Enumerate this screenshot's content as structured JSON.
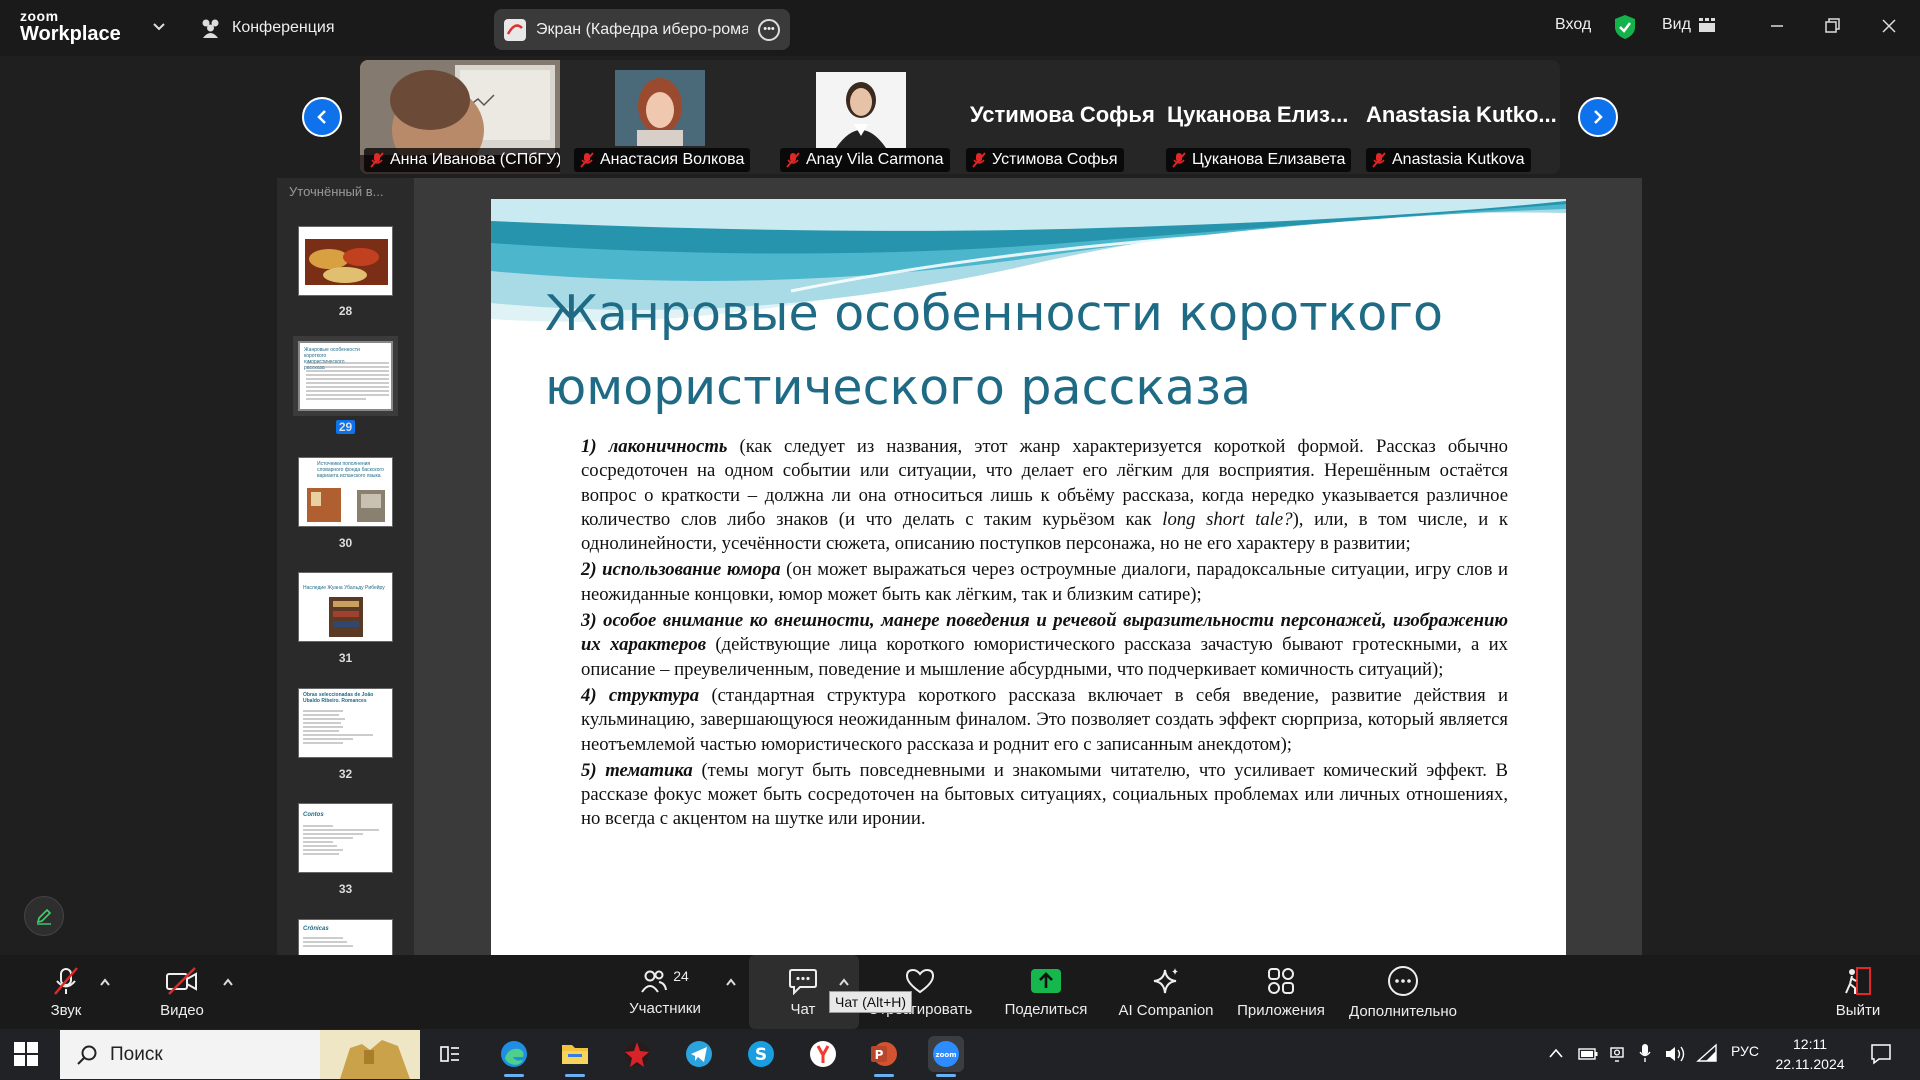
{
  "app": {
    "logo_top": "zoom",
    "logo_bottom": "Workplace",
    "conference_label": "Конференция",
    "share_title": "Экран (Кафедра иберо-романс",
    "sign_in": "Вход",
    "view": "Вид"
  },
  "gallery": {
    "participants": [
      {
        "name": "Анна Иванова (СПбГУ)"
      },
      {
        "name": "Анастасия Волкова"
      },
      {
        "name": "Anay Vila Carmona"
      },
      {
        "name": "Устимова Софья",
        "big": "Устимова Софья"
      },
      {
        "name": "Цуканова Елизавета",
        "big": "Цуканова Елиз..."
      },
      {
        "name": "Anastasia Kutkova",
        "big": "Anastasia Kutko..."
      }
    ]
  },
  "sidebar": {
    "title": "Уточнённый в...",
    "thumbs": [
      {
        "num": "28"
      },
      {
        "num": "29",
        "title": "Жанровые особенности короткого юмористического рассказа"
      },
      {
        "num": "30",
        "title": "Источники пополнения словарного фонда баскского варианта испанского языка"
      },
      {
        "num": "31",
        "title": "Наследие Жуана Убальду Рибейру"
      },
      {
        "num": "32",
        "title": "Obras seleccionadas de João Ubaldo Ribeiro. Romances"
      },
      {
        "num": "33",
        "title": "Contos"
      },
      {
        "num": "34",
        "title": "Crônicas"
      }
    ]
  },
  "slide": {
    "title_line1": "Жанровые особенности короткого",
    "title_line2": "юмористического рассказа",
    "items": [
      {
        "head": "1) лаконичность",
        "text": " (как следует из названия, этот жанр характеризуется короткой формой. Рассказ обычно сосредоточен на одном событии или ситуации, что делает его лёгким для восприятия. Нерешённым остаётся вопрос о краткости – должна ли она относиться лишь к объёму рассказа, когда нередко указывается различное количество слов либо знаков (и что делать с таким курьёзом как ",
        "italic": "long short tale?",
        "tail": "), или, в том числе,   и к однолинейности, усечённости  сюжета, описанию поступков персонажа, но не его характеру в развитии;"
      },
      {
        "head": "2) использование юмора",
        "text": " (он может выражаться через остроумные диалоги, парадоксальные ситуации, игру слов и неожиданные концовки, юмор может быть как лёгким, так и близким сатире);"
      },
      {
        "head": "3) особое внимание ко внешности, манере поведения и речевой выразительности  персонажей, изображению их  характеров",
        "text": "  (действующие  лица  короткого юмористического рассказа зачастую бывают гротескными, а их описание – преувеличенным,  поведение и мышление абсурдными, что подчеркивает комичность ситуаций);"
      },
      {
        "head": "4) структура",
        "text": " (стандартная структура короткого рассказа включает в себя введение, развитие действия и кульминацию, завершающуюся неожиданным финалом. Это позволяет создать эффект сюрприза, который является неотъемлемой частью юмористического рассказа и роднит его с записанным анекдотом);"
      },
      {
        "head": "5) тематика",
        "text": " (темы могут быть повседневными и знакомыми читателю, что усиливает комический эффект. В рассказе фокус может быть сосредоточен на бытовых ситуациях, социальных проблемах или личных отношениях, но всегда с акцентом на шутке или иронии."
      }
    ]
  },
  "toolbar": {
    "audio": "Звук",
    "video": "Видео",
    "participants": "Участники",
    "participants_count": "24",
    "chat": "Чат",
    "react": "Отреагировать",
    "share": "Поделиться",
    "ai": "AI Companion",
    "apps": "Приложения",
    "more": "Дополнительно",
    "leave": "Выйти",
    "chat_tooltip": "Чат (Alt+H)"
  },
  "taskbar": {
    "search": "Поиск",
    "lang": "РУС",
    "time": "12:11",
    "date": "22.11.2024"
  },
  "colors": {
    "accent": "#0e72ed",
    "share_green": "#00c853",
    "slide_title": "#1f6b86",
    "muted_red": "#e02828"
  }
}
